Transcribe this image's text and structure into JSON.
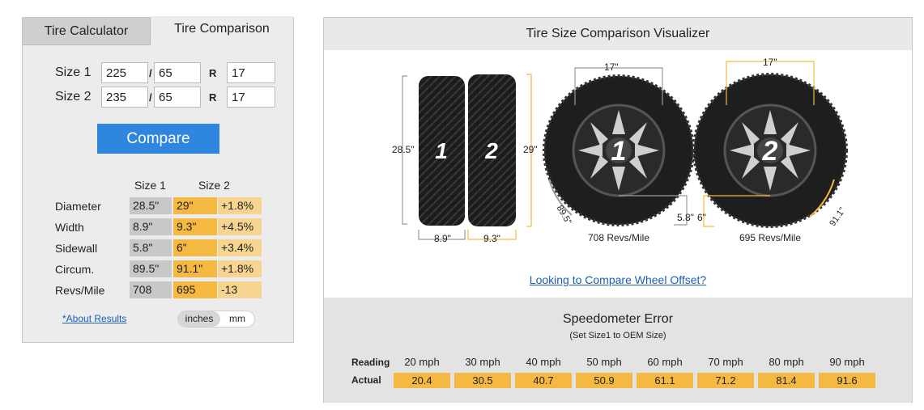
{
  "tabs": {
    "calculator": "Tire Calculator",
    "comparison": "Tire Comparison"
  },
  "size1": {
    "label": "Size 1",
    "width": "225",
    "aspect": "65",
    "r_label": "R",
    "diameter": "17"
  },
  "size2": {
    "label": "Size 2",
    "width": "235",
    "aspect": "65",
    "r_label": "R",
    "diameter": "17"
  },
  "slash": "/",
  "compare_button": "Compare",
  "results": {
    "header_size1": "Size 1",
    "header_size2": "Size 2",
    "rows": [
      {
        "label": "Diameter",
        "s1": "28.5\"",
        "s2": "29\"",
        "diff": "+1.8%"
      },
      {
        "label": "Width",
        "s1": "8.9\"",
        "s2": "9.3\"",
        "diff": "+4.5%"
      },
      {
        "label": "Sidewall",
        "s1": "5.8\"",
        "s2": "6\"",
        "diff": "+3.4%"
      },
      {
        "label": "Circum.",
        "s1": "89.5\"",
        "s2": "91.1\"",
        "diff": "+1.8%"
      },
      {
        "label": "Revs/Mile",
        "s1": "708",
        "s2": "695",
        "diff": "-13"
      }
    ]
  },
  "about_link": "*About Results",
  "units": {
    "inches": "inches",
    "mm": "mm",
    "selected": "inches"
  },
  "visualizer": {
    "title": "Tire Size Comparison Visualizer",
    "tire1_number": "1",
    "tire2_number": "2",
    "tire1_height": "28.5\"",
    "tire2_height": "29\"",
    "tire1_width": "8.9\"",
    "tire2_width": "9.3\"",
    "wheel1_diameter": "17\"",
    "wheel2_diameter": "17\"",
    "tire1_sidewall": "5.8\"",
    "tire2_sidewall": "6\"",
    "tire1_circum": "89.5\"",
    "tire2_circum": "91.1\"",
    "tire1_revs": "708 Revs/Mile",
    "tire2_revs": "695 Revs/Mile",
    "colors": {
      "size1": "#9a9a9a",
      "size2": "#f5b942"
    }
  },
  "offset_link": "Looking to Compare Wheel Offset?",
  "speedometer": {
    "title": "Speedometer Error",
    "subtitle": "(Set Size1 to OEM Size)",
    "reading_label": "Reading",
    "actual_label": "Actual",
    "readings": [
      "20 mph",
      "30 mph",
      "40 mph",
      "50 mph",
      "60 mph",
      "70 mph",
      "80 mph",
      "90 mph"
    ],
    "actuals": [
      "20.4",
      "30.5",
      "40.7",
      "50.9",
      "61.1",
      "71.2",
      "81.4",
      "91.6"
    ]
  }
}
